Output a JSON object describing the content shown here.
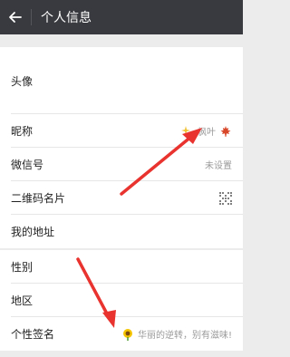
{
  "header": {
    "title": "个人信息"
  },
  "profile": {
    "rows": [
      {
        "label": "头像",
        "value": ""
      },
      {
        "label": "昵称",
        "value": "枫叶"
      },
      {
        "label": "微信号",
        "value": "未设置"
      },
      {
        "label": "二维码名片",
        "value": ""
      },
      {
        "label": "我的地址",
        "value": ""
      }
    ]
  },
  "details": {
    "rows": [
      {
        "label": "性别",
        "value": ""
      },
      {
        "label": "地区",
        "value": ""
      },
      {
        "label": "个性签名",
        "value": "华丽的逆转，别有滋味!"
      }
    ]
  },
  "colors": {
    "topbar_bg": "#393a3f",
    "arrow": "#e8332e",
    "page_bg": "#ececec"
  },
  "icons": {
    "back": "back-arrow-icon",
    "sparkle": "sparkles-icon",
    "leaf": "maple-leaf-icon",
    "qr": "qr-code-icon",
    "sunflower": "sunflower-icon"
  }
}
